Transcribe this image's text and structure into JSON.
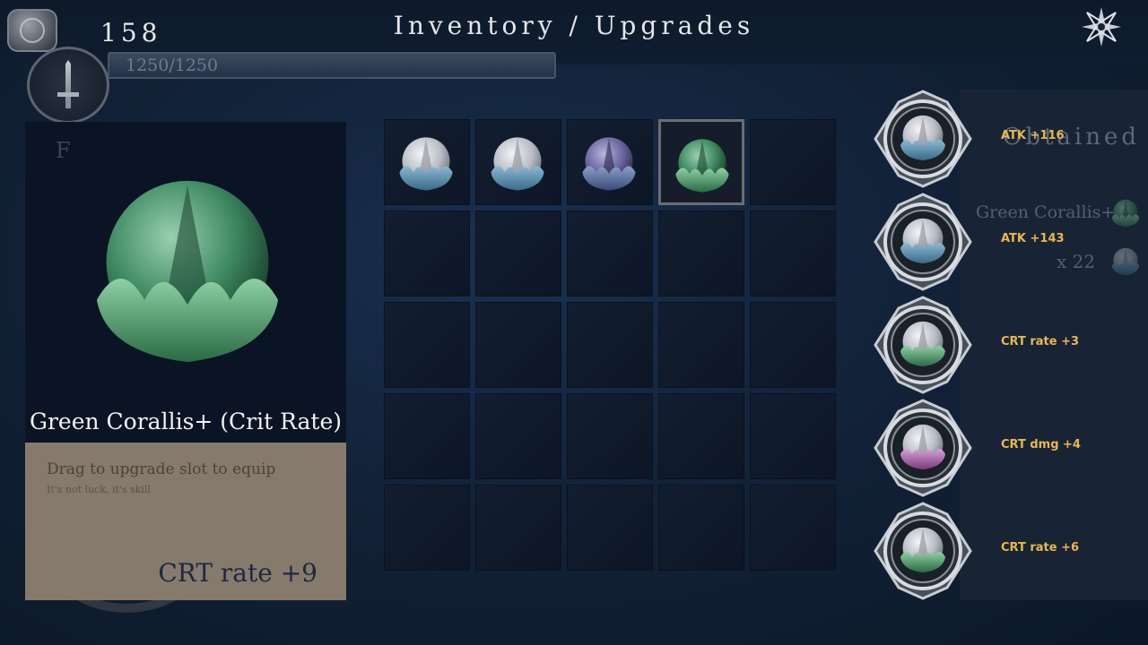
{
  "header": {
    "title": "Inventory  /  Upgrades",
    "gold": "158",
    "hp_text": "1250/1250",
    "hp_fraction": 1.0
  },
  "detail": {
    "mark": "F",
    "item_name": "Green Corallis+ (Crit Rate)",
    "hint": "Drag to upgrade slot to equip",
    "flavor": "It's not luck, it's skill",
    "stat": "CRT rate +9"
  },
  "inventory": {
    "slots": [
      {
        "gem": "white-blue",
        "selected": false
      },
      {
        "gem": "white-blue",
        "selected": false
      },
      {
        "gem": "purple",
        "selected": false
      },
      {
        "gem": "green",
        "selected": true
      }
    ]
  },
  "upgrades": {
    "obtained_label": "Obtained",
    "obtained_name": "Green Corallis+",
    "obtained_count": "x 22",
    "slots": [
      {
        "stat": "ATK +116",
        "gem": "white-blue"
      },
      {
        "stat": "ATK +143",
        "gem": "white-blue"
      },
      {
        "stat": "CRT rate +3",
        "gem": "white-green"
      },
      {
        "stat": "CRT dmg +4",
        "gem": "white-pink"
      },
      {
        "stat": "CRT rate +6",
        "gem": "white-green"
      }
    ]
  },
  "colors": {
    "stat_text": "#e8b84a",
    "gem_white": "#d8dade",
    "gem_blue": "#6a9ab8",
    "gem_green": "#3f8a62",
    "gem_purple": "#7c78b0",
    "gem_pink": "#b07cb4",
    "desc_panel": "#857a6c"
  }
}
